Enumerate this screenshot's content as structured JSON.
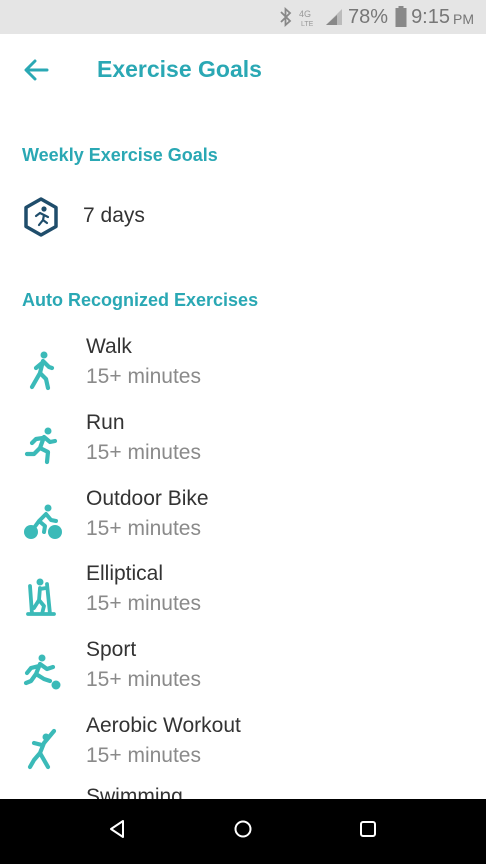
{
  "status_bar": {
    "battery": "78%",
    "time": "9:15",
    "ampm": "PM",
    "icons": [
      "bluetooth-icon",
      "4g-lte-icon",
      "signal-icon",
      "battery-icon"
    ]
  },
  "header": {
    "title": "Exercise Goals",
    "back_icon": "arrow-left-icon"
  },
  "weekly": {
    "header": "Weekly Exercise Goals",
    "value": "7 days",
    "icon": "exercise-hexagon-icon"
  },
  "auto": {
    "header": "Auto Recognized Exercises",
    "items": [
      {
        "name": "Walk",
        "duration": "15+ minutes",
        "icon": "walk-icon"
      },
      {
        "name": "Run",
        "duration": "15+ minutes",
        "icon": "run-icon"
      },
      {
        "name": "Outdoor Bike",
        "duration": "15+ minutes",
        "icon": "bike-icon"
      },
      {
        "name": "Elliptical",
        "duration": "15+ minutes",
        "icon": "elliptical-icon"
      },
      {
        "name": "Sport",
        "duration": "15+ minutes",
        "icon": "sport-icon"
      },
      {
        "name": "Aerobic Workout",
        "duration": "15+ minutes",
        "icon": "aerobic-icon"
      },
      {
        "name": "Swimming",
        "duration": "",
        "icon": "swim-icon"
      }
    ]
  },
  "colors": {
    "accent": "#2aa8b4",
    "icon": "#3bbab8",
    "primary_text": "#333333",
    "secondary_text": "#8a8a8a",
    "navbar": "#000000",
    "statusbar": "#e5e5e5"
  },
  "nav_bar": {
    "buttons": [
      "back-nav-icon",
      "home-nav-icon",
      "recents-nav-icon"
    ]
  }
}
